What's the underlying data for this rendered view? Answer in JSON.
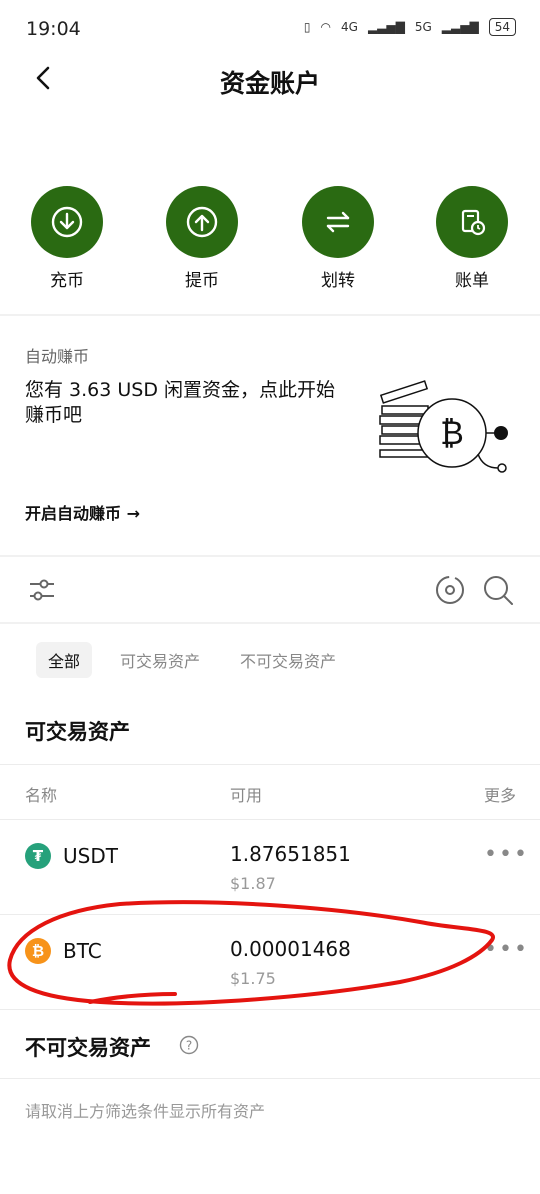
{
  "status": {
    "time": "19:04",
    "network1": "4G",
    "network2": "5G",
    "battery": "54"
  },
  "header": {
    "title": "资金账户"
  },
  "actions": [
    {
      "label": "充币",
      "icon": "deposit-icon"
    },
    {
      "label": "提币",
      "icon": "withdraw-icon"
    },
    {
      "label": "划转",
      "icon": "transfer-icon"
    },
    {
      "label": "账单",
      "icon": "bill-icon"
    }
  ],
  "earn": {
    "caption": "自动赚币",
    "text": "您有 3.63 USD 闲置资金，点此开始赚币吧",
    "link": "开启自动赚币 →"
  },
  "tabs": [
    "全部",
    "可交易资产",
    "不可交易资产"
  ],
  "tradable": {
    "title": "可交易资产",
    "columns": {
      "name": "名称",
      "available": "可用",
      "more": "更多"
    },
    "rows": [
      {
        "symbol": "USDT",
        "amount": "1.87651851",
        "usd": "$1.87",
        "color": "#26a17b",
        "glyph": "₮"
      },
      {
        "symbol": "BTC",
        "amount": "0.00001468",
        "usd": "$1.75",
        "color": "#f7931a",
        "glyph": "₿"
      }
    ]
  },
  "nontradable": {
    "title": "不可交易资产",
    "hint": "请取消上方筛选条件显示所有资产"
  }
}
